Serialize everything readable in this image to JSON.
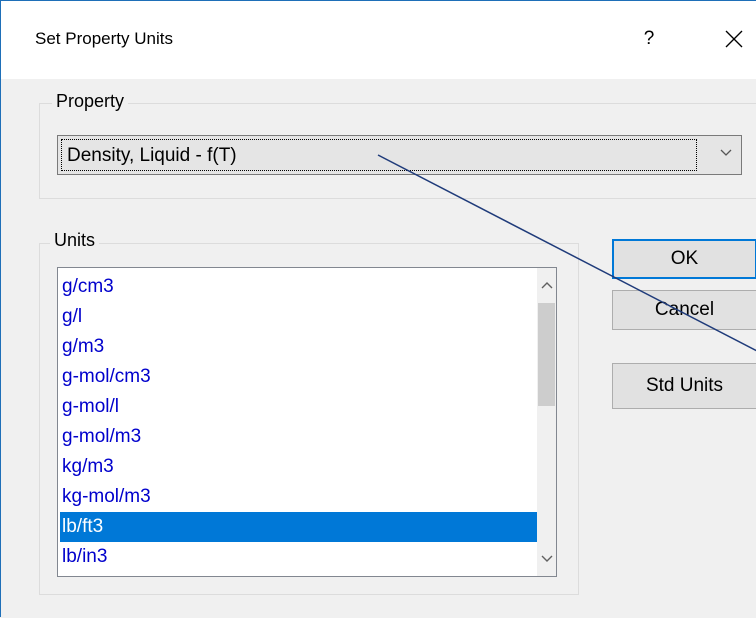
{
  "window": {
    "title": "Set Property Units",
    "help_label": "?",
    "close_label": "✕"
  },
  "property_group": {
    "label": "Property",
    "selected_value": "Density, Liquid - f(T)"
  },
  "units_group": {
    "label": "Units",
    "items": [
      "g/cm3",
      "g/l",
      "g/m3",
      "g-mol/cm3",
      "g-mol/l",
      "g-mol/m3",
      "kg/m3",
      "kg-mol/m3",
      "lb/ft3",
      "lb/in3"
    ],
    "selected_item": "lb/ft3"
  },
  "buttons": {
    "ok": "OK",
    "cancel": "Cancel",
    "std_units": "Std Units"
  },
  "icons": {
    "combo_arrow": "chevron-down-icon",
    "scroll_up": "chevron-up-icon",
    "scroll_down": "chevron-down-icon"
  },
  "colors": {
    "accent": "#0078d7",
    "list_text": "#0000cc",
    "annotation_line": "#1f3b7a"
  }
}
